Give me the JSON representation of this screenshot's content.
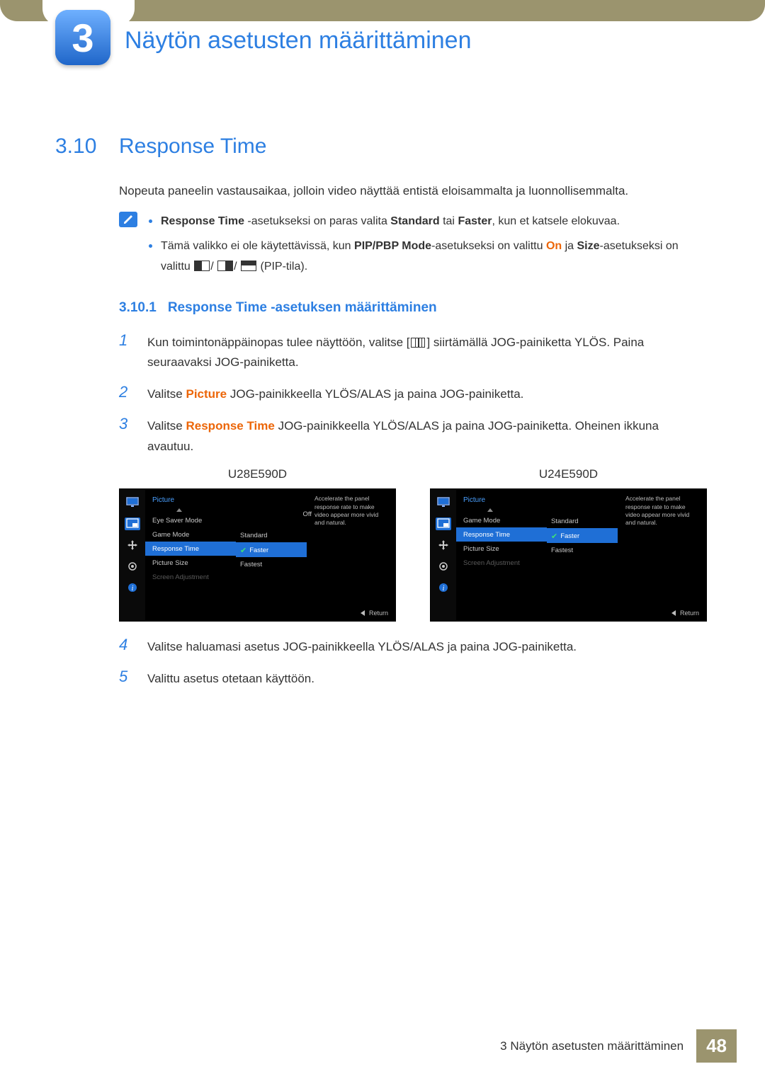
{
  "chapter": {
    "number": "3",
    "title": "Näytön asetusten määrittäminen"
  },
  "section": {
    "number": "3.10",
    "title": "Response Time"
  },
  "intro": "Nopeuta paneelin vastausaikaa, jolloin video näyttää entistä eloisammalta ja luonnollisemmalta.",
  "notes": {
    "n1_a": "Response Time",
    "n1_b": " -asetukseksi on paras valita ",
    "n1_c": "Standard",
    "n1_d": " tai ",
    "n1_e": "Faster",
    "n1_f": ", kun et katsele elokuvaa.",
    "n2_a": "Tämä valikko ei ole käytettävissä, kun ",
    "n2_b": "PIP/PBP Mode",
    "n2_c": "-asetukseksi on valittu ",
    "n2_d": "On",
    "n2_e": " ja ",
    "n2_f": "Size",
    "n2_g": "-asetukseksi on valittu ",
    "n2_h": " (PIP-tila)."
  },
  "subsection": {
    "number": "3.10.1",
    "title": "Response Time -asetuksen määrittäminen"
  },
  "steps": {
    "s1_a": "Kun toimintonäppäinopas tulee näyttöön, valitse [",
    "s1_b": "] siirtämällä JOG-painiketta YLÖS. Paina seuraavaksi JOG-painiketta.",
    "s2_a": "Valitse ",
    "s2_b": "Picture",
    "s2_c": " JOG-painikkeella YLÖS/ALAS ja paina JOG-painiketta.",
    "s3_a": "Valitse ",
    "s3_b": "Response Time",
    "s3_c": " JOG-painikkeella YLÖS/ALAS ja paina JOG-painiketta. Oheinen ikkuna avautuu.",
    "s4": "Valitse haluamasi asetus JOG-painikkeella YLÖS/ALAS ja paina JOG-painiketta.",
    "s5": "Valittu asetus otetaan käyttöön."
  },
  "osd": {
    "model1": "U28E590D",
    "model2": "U24E590D",
    "heading": "Picture",
    "desc": "Accelerate the panel response rate to make video appear more vivid and natural.",
    "return": "Return",
    "off": "Off",
    "items1": {
      "eye": "Eye Saver Mode",
      "game": "Game Mode",
      "resp": "Response Time",
      "size": "Picture Size",
      "adj": "Screen Adjustment"
    },
    "items2": {
      "game": "Game Mode",
      "resp": "Response Time",
      "size": "Picture Size",
      "adj": "Screen Adjustment"
    },
    "opts": {
      "standard": "Standard",
      "faster": "Faster",
      "fastest": "Fastest"
    }
  },
  "footer": {
    "text": "3 Näytön asetusten määrittäminen",
    "page": "48"
  }
}
